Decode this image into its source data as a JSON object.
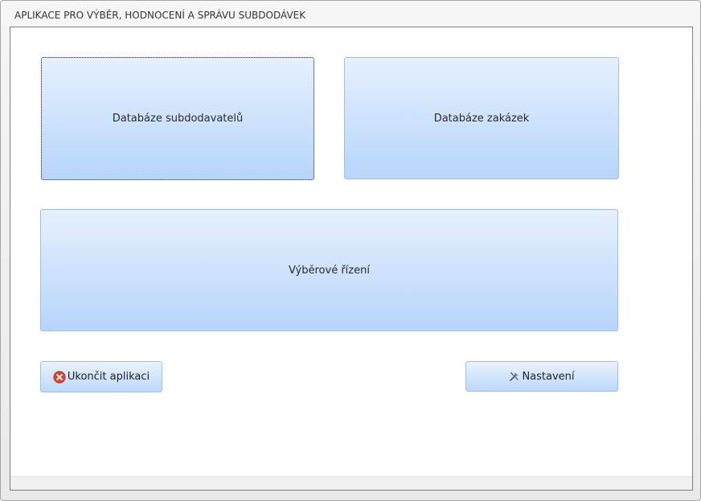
{
  "window": {
    "title": "APLIKACE PRO VÝBĚR, HODNOCENÍ A SPRÁVU SUBDODÁVEK"
  },
  "main": {
    "buttons": {
      "subcontractors_db": "Databáze subdodavatelů",
      "orders_db": "Databáze zakázek",
      "tender": "Výběrové řízení",
      "exit_app": "Ukončit aplikaci",
      "settings": "Nastavení"
    }
  },
  "icons": {
    "exit_icon": "close-circle-icon",
    "settings_icon": "tools-icon"
  },
  "colors": {
    "button_top": "#e6f0fc",
    "button_bottom": "#b7d5fb",
    "button_border": "#9fbfe0",
    "exit_icon_red": "#d9452b"
  }
}
